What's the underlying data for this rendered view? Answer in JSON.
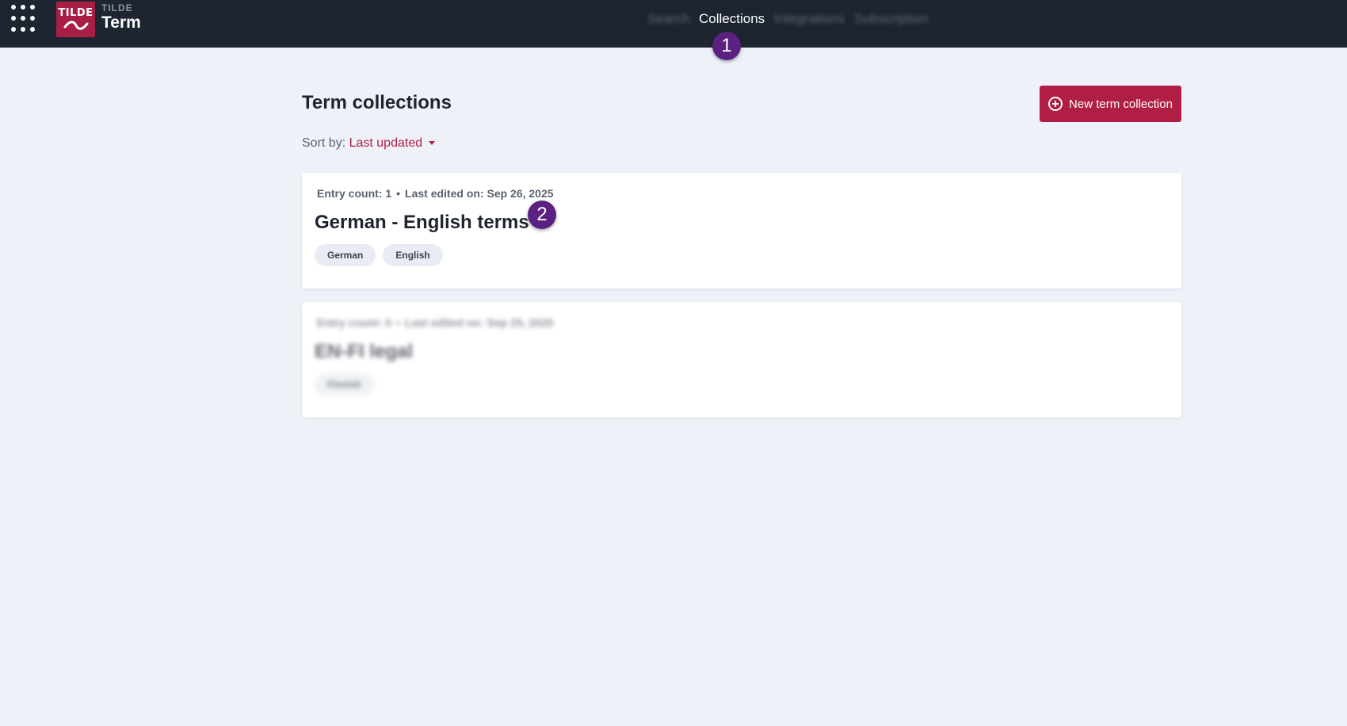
{
  "header": {
    "logo_text": "TILDE",
    "brand_small": "TILDE",
    "brand_title": "Term",
    "nav": [
      {
        "label": "Search",
        "active": false
      },
      {
        "label": "Collections",
        "active": true
      },
      {
        "label": "Integrations",
        "active": false
      },
      {
        "label": "Subscription",
        "active": false
      }
    ]
  },
  "annotations": [
    "1",
    "2"
  ],
  "main": {
    "title": "Term collections",
    "new_button_label": "New term collection",
    "sort": {
      "prefix": "Sort by:",
      "value": "Last updated"
    },
    "collections": [
      {
        "entry_count_label": "Entry count: 1",
        "separator": "•",
        "last_edited_label": "Last edited on: Sep 26, 2025",
        "name": "German - English terms",
        "tags": [
          "German",
          "English"
        ]
      },
      {
        "entry_count_label": "Entry count: 0",
        "separator": "•",
        "last_edited_label": "Last edited on: Sep 25, 2025",
        "name": "EN-FI legal",
        "tags": [
          "Finnish"
        ]
      }
    ]
  },
  "colors": {
    "topbar": "#1c2530",
    "accent": "#b01e46",
    "badge": "#5b2180",
    "background": "#eef1f8"
  }
}
